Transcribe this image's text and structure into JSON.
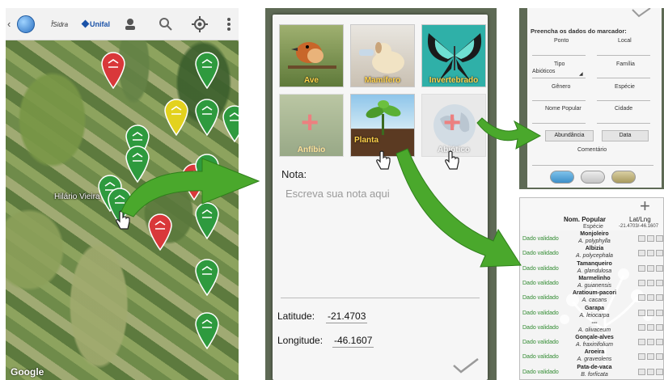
{
  "map": {
    "place_label": "Hilário Vieira",
    "attribution": "Google",
    "toolbar_icons": [
      "globe-icon",
      "logo-icon",
      "unifal-logo",
      "user-icon",
      "search-icon",
      "gps-target-icon",
      "more-vert-icon"
    ],
    "logo_text": "ꝉ̂Sidra",
    "brand": "Unifal"
  },
  "form": {
    "categories": [
      {
        "label": "Ave",
        "state": "default"
      },
      {
        "label": "Mamífero",
        "state": "default"
      },
      {
        "label": "Invertebrado",
        "state": "default"
      },
      {
        "label": "Anfíbio",
        "state": "dim"
      },
      {
        "label": "Planta",
        "state": "default"
      },
      {
        "label": "Abiótico",
        "state": "dim"
      }
    ],
    "note_label": "Nota:",
    "note_placeholder": "Escreva sua nota aqui",
    "latitude_label": "Latitude:",
    "latitude_value": "-21.4703",
    "longitude_label": "Longitude:",
    "longitude_value": "-46.1607"
  },
  "marker_data": {
    "title": "Preencha os dados do marcador:",
    "fields": [
      "Ponto",
      "Local",
      "Tipo",
      "Família",
      "Gênero",
      "Espécie",
      "Nome Popular",
      "Cidade"
    ],
    "tipo_value": "Abióticos",
    "abundance_button": "Abundância",
    "date_button": "Data",
    "comment_label": "Comentário"
  },
  "records": {
    "col_name": "Nom. Popular",
    "col_species": "Espécie",
    "col_latlng": "Lat/Lng",
    "latlng_value": "-21.4703/-46.1607",
    "rows": [
      {
        "status": "Dado validado",
        "common": "Monjoleiro",
        "species": "A. polyphylla"
      },
      {
        "status": "Dado validado",
        "common": "Albizia",
        "species": "A. polycephala"
      },
      {
        "status": "Dado validado",
        "common": "Tamanqueiro",
        "species": "A. glandulosa"
      },
      {
        "status": "Dado validado",
        "common": "Marmelinho",
        "species": "A. guianensis"
      },
      {
        "status": "Dado validado",
        "common": "Aratioum-pacori",
        "species": "A. cacans"
      },
      {
        "status": "Dado validado",
        "common": "Garapa",
        "species": "A. leiocarpa"
      },
      {
        "status": "Dado validado",
        "common": "---",
        "species": "A. olivaceum"
      },
      {
        "status": "Dado validado",
        "common": "Gonçale-alves",
        "species": "A. fraxinifolium"
      },
      {
        "status": "Dado validado",
        "common": "Aroeira",
        "species": "A. graveolens"
      },
      {
        "status": "Dado validado",
        "common": "Pata-de-vaca",
        "species": "B. forficata"
      }
    ]
  },
  "colors": {
    "pin_green": "#2e9a3e",
    "pin_red": "#d9383a",
    "pin_yellow": "#e3d21e",
    "arrow_green": "#4aa82c",
    "validated_text": "#2f8a2f"
  }
}
